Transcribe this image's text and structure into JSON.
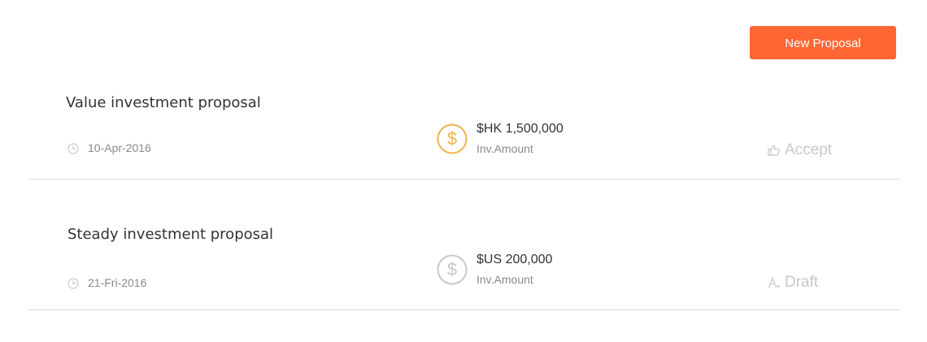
{
  "header": {
    "new_proposal_label": "New Proposal",
    "accent_color": "#ff6633"
  },
  "proposals": [
    {
      "title": "Value investment proposal",
      "date": "10-Apr-2016",
      "amount": "$HK 1,500,000",
      "amount_label": "Inv.Amount",
      "amount_icon": "dollar-coin-icon",
      "amount_icon_color": "#f2b24b",
      "status": "Accept",
      "status_icon": "thumbs-up-icon"
    },
    {
      "title": "Steady investment proposal",
      "date": "21-Fri-2016",
      "amount": "$US 200,000",
      "amount_label": "Inv.Amount",
      "amount_icon": "dollar-coin-icon",
      "amount_icon_color": "#c8c8c8",
      "status": "Draft",
      "status_icon": "draft-pen-icon"
    }
  ]
}
